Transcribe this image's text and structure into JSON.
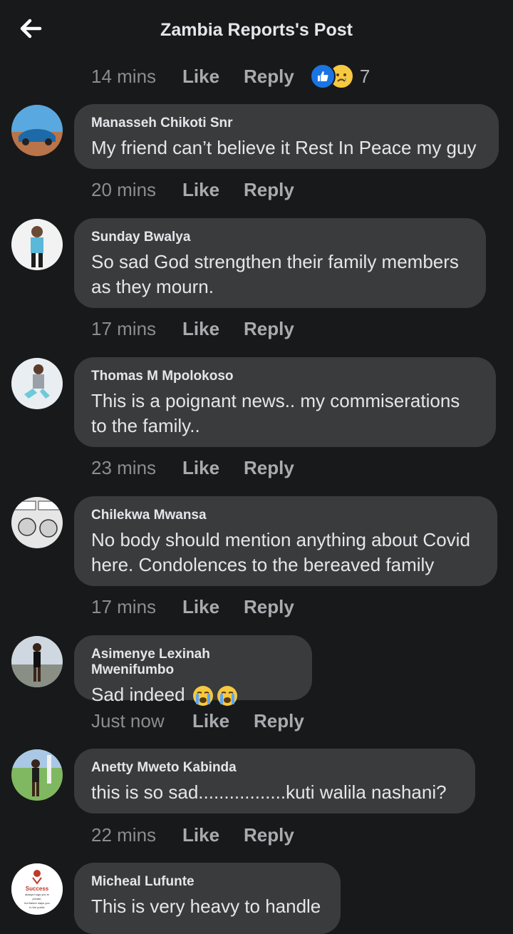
{
  "header": {
    "title": "Zambia Reports's Post"
  },
  "top_meta": {
    "time": "14 mins",
    "like": "Like",
    "reply": "Reply",
    "reaction_count": "7"
  },
  "comments": [
    {
      "author": "Manasseh Chikoti Snr",
      "text": "My friend can’t believe it Rest In Peace my guy",
      "time": "20 mins",
      "like": "Like",
      "reply": "Reply"
    },
    {
      "author": "Sunday Bwalya",
      "text": "So sad God strengthen their family members as they mourn.",
      "time": "17 mins",
      "like": "Like",
      "reply": "Reply"
    },
    {
      "author": "Thomas M Mpolokoso",
      "text": "This is a poignant news..  my commiserations to the family..",
      "time": "23 mins",
      "like": "Like",
      "reply": "Reply"
    },
    {
      "author": "Chilekwa Mwansa",
      "text": "No body should mention anything about Covid here. Condolences to the bereaved family",
      "time": "17 mins",
      "like": "Like",
      "reply": "Reply"
    },
    {
      "author": "Asimenye Lexinah Mwenifumbo",
      "text": "Sad indeed",
      "time": "Just now",
      "like": "Like",
      "reply": "Reply"
    },
    {
      "author": "Anetty Mweto Kabinda",
      "text": "this is so sad.................kuti walila nashani?",
      "time": "22 mins",
      "like": "Like",
      "reply": "Reply"
    },
    {
      "author": "Micheal Lufunte",
      "text": "This is very heavy to handle"
    }
  ],
  "avatar_7_caption": [
    "Success",
    "always hugs you in",
    "private,",
    "but failure slaps you",
    "in the public"
  ],
  "icons": {
    "back": "arrow-left-icon",
    "like_reaction": "thumbs-up-icon",
    "sad_reaction": "sad-face-icon",
    "crying": "loudly-crying-emoji"
  },
  "colors": {
    "background": "#18191a",
    "bubble": "#3a3b3c",
    "like_blue": "#1b74e4"
  }
}
